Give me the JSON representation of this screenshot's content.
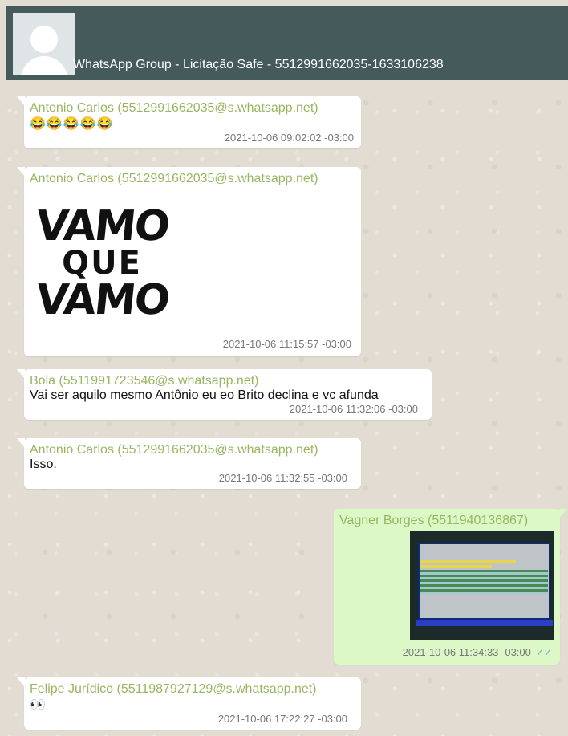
{
  "header": {
    "title": "WhatsApp Group - Licitação Safe - 5512991662035-1633106238"
  },
  "messages": [
    {
      "direction": "in",
      "sender": "Antonio Carlos (5512991662035@s.whatsapp.net)",
      "text": "😂😂😂😂😂",
      "time": "2021-10-06 09:02:02 -03:00"
    },
    {
      "direction": "in",
      "sender": "Antonio Carlos (5512991662035@s.whatsapp.net)",
      "sticker_lines": [
        "VAMO",
        "QUE",
        "VAMO"
      ],
      "time": "2021-10-06 11:15:57 -03:00"
    },
    {
      "direction": "in",
      "sender": "Bola (5511991723546@s.whatsapp.net)",
      "text": "Vai ser aquilo mesmo Antônio eu eo Brito declina e vc afunda",
      "time": "2021-10-06 11:32:06 -03:00"
    },
    {
      "direction": "in",
      "sender": "Antonio Carlos (5512991662035@s.whatsapp.net)",
      "text": "Isso.",
      "time": "2021-10-06 11:32:55 -03:00"
    },
    {
      "direction": "out",
      "sender": "Vagner Borges (5511940136867)",
      "time": "2021-10-06 11:34:33 -03:00",
      "ticks": "✓✓"
    },
    {
      "direction": "in",
      "sender": "Felipe Jurídico (5511987927129@s.whatsapp.net)",
      "text": "👀",
      "time": "2021-10-06 17:22:27 -03:00"
    }
  ],
  "colors": {
    "header_bg": "#455a5a",
    "sender": "#9ab562",
    "outgoing_bubble": "#dcf8c6",
    "read_ticks": "#6fa8dc"
  }
}
